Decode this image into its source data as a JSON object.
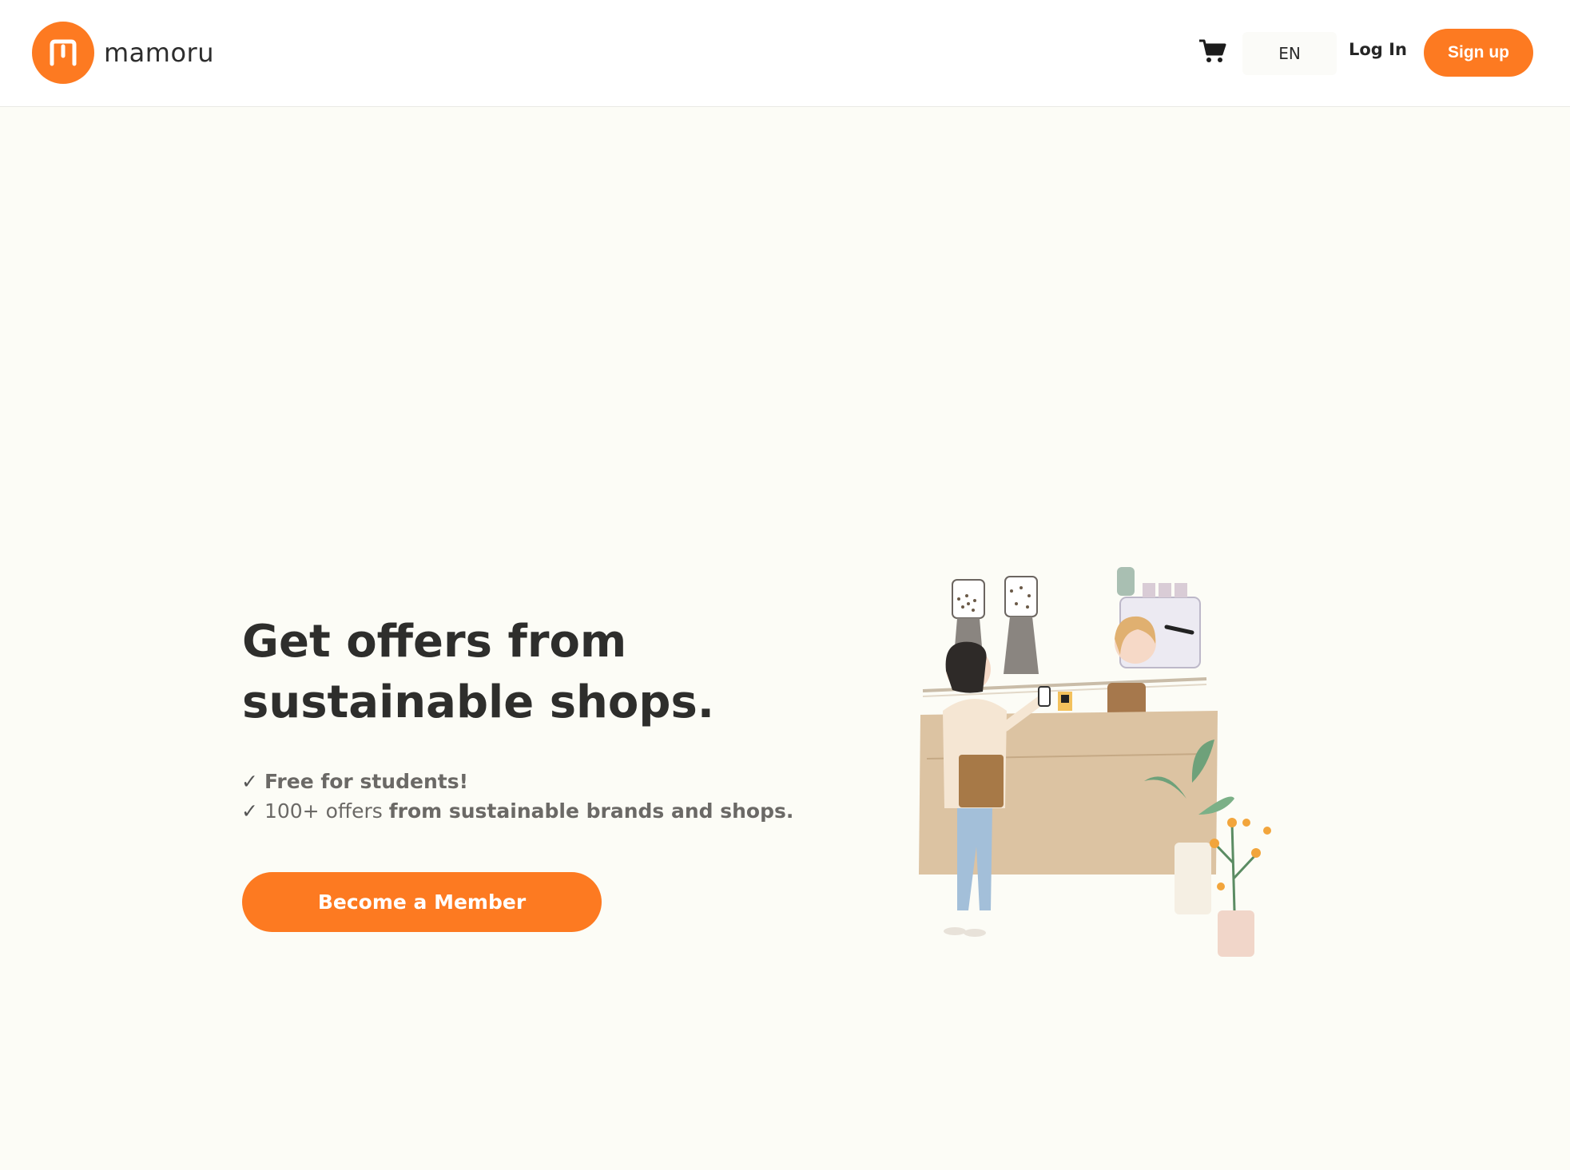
{
  "header": {
    "brand_name": "mamoru",
    "lang": "EN",
    "login_label": "Log In",
    "signup_label": "Sign up"
  },
  "hero": {
    "headline_line1": "Get offers from",
    "headline_line2": "sustainable shops.",
    "features": [
      {
        "check": "✓",
        "bold": "Free for students!"
      },
      {
        "check": "✓",
        "normal": "100+ offers",
        "bold": "from sustainable brands and shops."
      }
    ],
    "cta_label": "Become a Member"
  },
  "colors": {
    "accent": "#fd7a21",
    "background": "#fcfcf6",
    "header_bg": "#ffffff",
    "text_dark": "#2e2e2c",
    "text_muted": "#6b6966"
  },
  "icons": {
    "logo": "mamoru-logo-icon",
    "cart": "cart-icon"
  }
}
